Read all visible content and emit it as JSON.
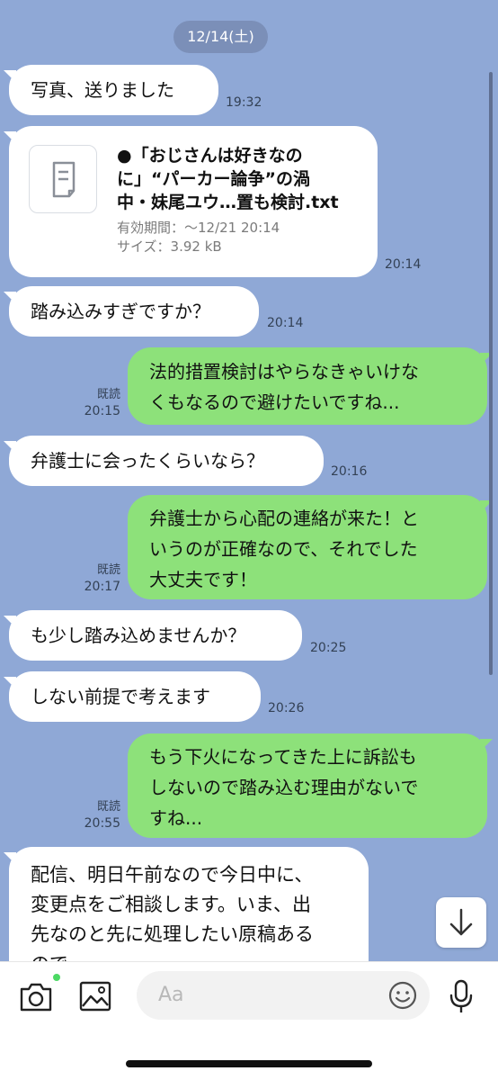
{
  "date": "12/14(土)",
  "messages": [
    {
      "text": "写真、送りました",
      "time": "19:32"
    },
    {
      "file": {
        "title": "●「おじさんは好きなのに」“パーカー論争”の渦中・妹尾ユウ…置も検討.txt",
        "title_lines": [
          "●「おじさんは好きなの",
          "に」“パーカー論争”の渦",
          "中・妹尾ユウ…置も検討.txt"
        ],
        "expiry": "有効期間：〜12/21 20:14",
        "size": "サイズ：3.92 kB"
      },
      "time": "20:14"
    },
    {
      "text": "踏み込みすぎですか？",
      "time": "20:14"
    },
    {
      "lines": [
        "法的措置検討はやらなきゃいけな",
        "くもなるので避けたいですね..."
      ],
      "read": "既読",
      "time": "20:15"
    },
    {
      "text": "弁護士に会ったくらいなら？",
      "time": "20:16"
    },
    {
      "lines": [
        "弁護士から心配の連絡が来た！と",
        "いうのが正確なので、それでした",
        "大丈夫です！"
      ],
      "read": "既読",
      "time": "20:17"
    },
    {
      "text": "も少し踏み込めませんか？",
      "time": "20:25"
    },
    {
      "text": "しない前提で考えます",
      "time": "20:26"
    },
    {
      "lines": [
        "もう下火になってきた上に訴訟も",
        "しないので踏み込む理由がないで",
        "すね..."
      ],
      "read": "既読",
      "time": "20:55"
    },
    {
      "lines": [
        "配信、明日午前なので今日中に、",
        "変更点をご相談します。いま、出",
        "先なのと先に処理したい原稿ある",
        "ので"
      ]
    }
  ],
  "input": {
    "placeholder": "Aa"
  },
  "icons": {
    "camera": "camera-icon",
    "image": "image-icon",
    "emoji": "emoji-icon",
    "mic": "mic-icon",
    "down": "arrow-down-icon"
  },
  "colors": {
    "background": "#8fa8d6",
    "sent_bubble": "#8de17a",
    "received_bubble": "#ffffff",
    "notify_dot": "#4cd964"
  }
}
